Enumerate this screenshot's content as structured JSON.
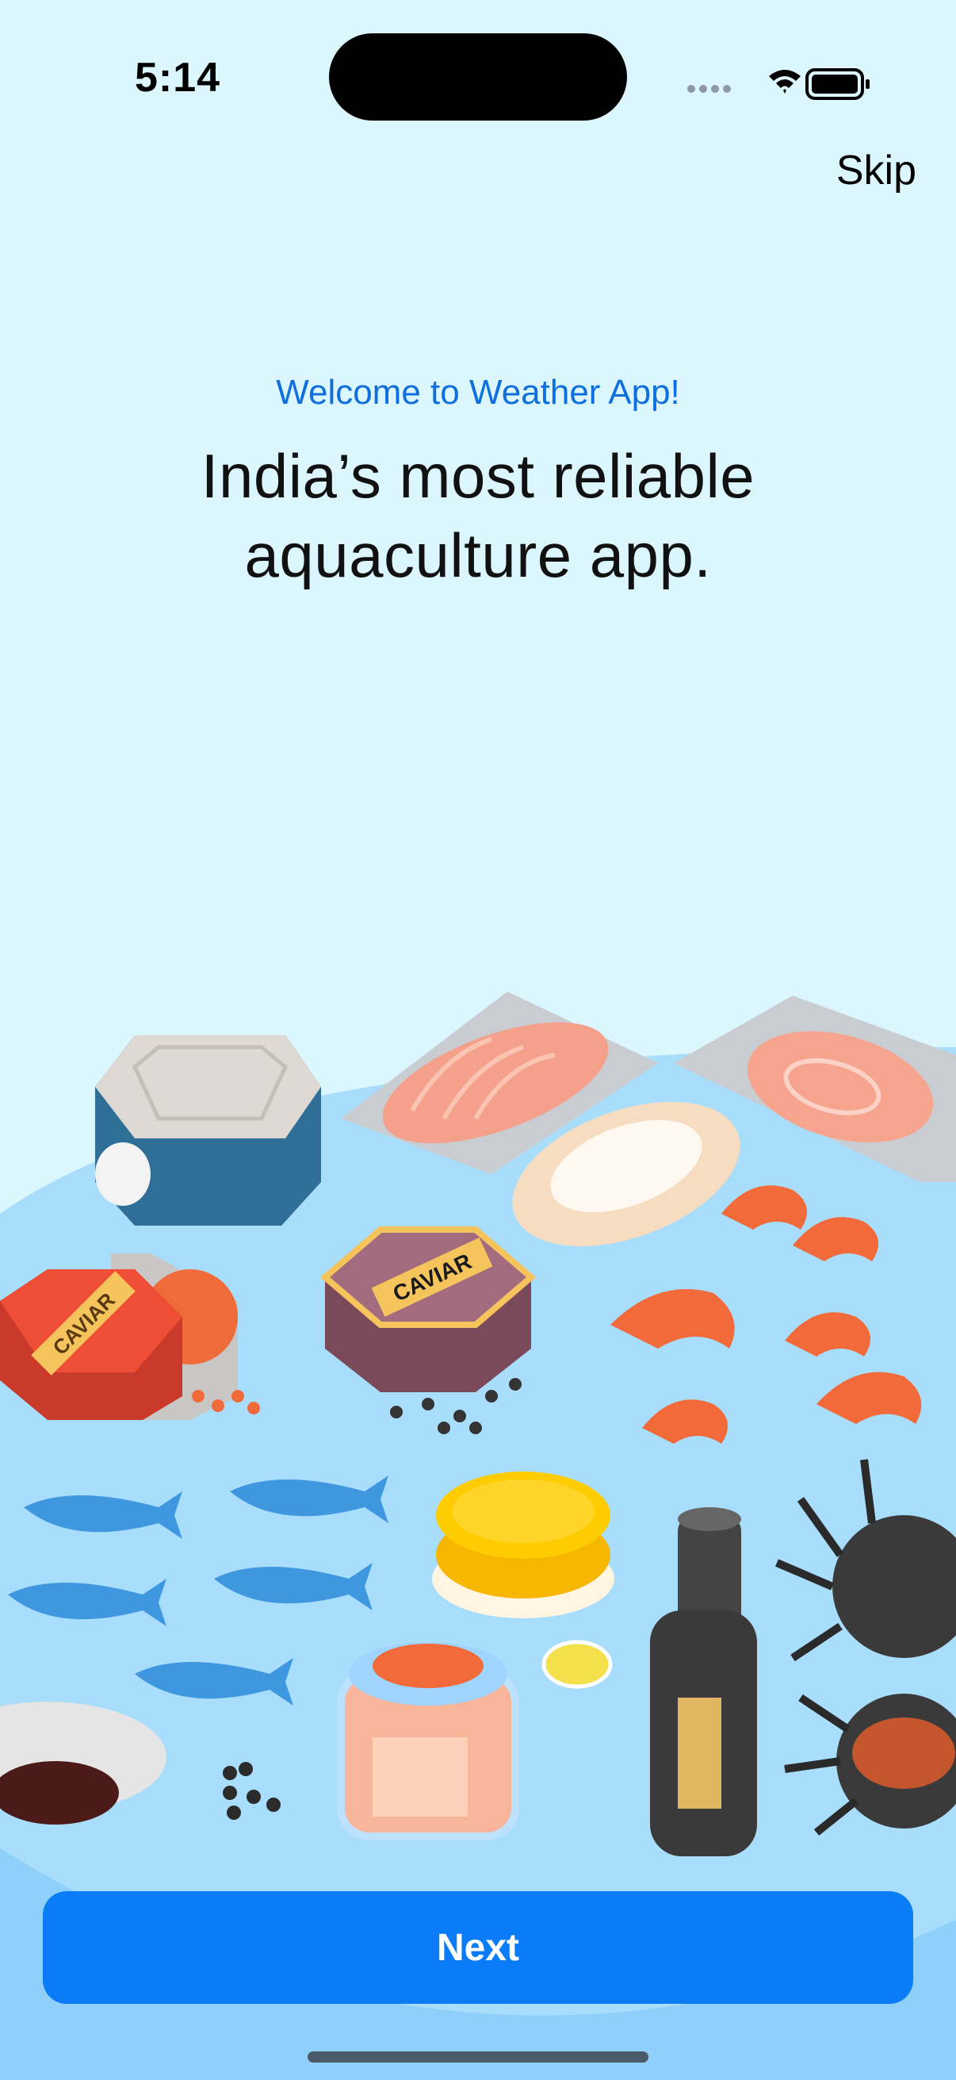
{
  "status_bar": {
    "time": "5:14"
  },
  "header": {
    "skip_label": "Skip"
  },
  "onboarding": {
    "welcome": "Welcome to Weather App!",
    "headline_line1": "India’s most reliable",
    "headline_line2": "aquaculture app."
  },
  "illustration": {
    "caviar_tin_label_1": "CAVIAR",
    "caviar_tin_label_2": "CAVIAR"
  },
  "footer": {
    "next_label": "Next"
  },
  "colors": {
    "background": "#dcf6fe",
    "accent": "#0a7cf8",
    "welcome_text": "#0f6fdc"
  }
}
